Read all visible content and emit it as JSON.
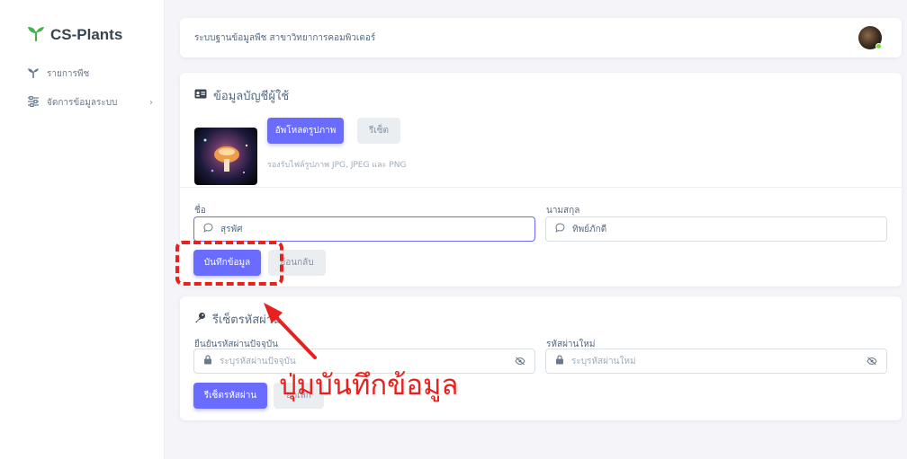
{
  "sidebar": {
    "brand": "CS-Plants",
    "items": [
      {
        "label": "รายการพืช"
      },
      {
        "label": "จัดการข้อมูลระบบ"
      }
    ]
  },
  "navbar": {
    "title": "ระบบฐานข้อมูลพืช สาขาวิทยาการคอมพิวเตอร์"
  },
  "account": {
    "title": "ข้อมูลบัญชีผู้ใช้",
    "upload_label": "อัพโหลดรูปภาพ",
    "reset_label": "รีเซ็ต",
    "upload_hint": "รองรับไฟล์รูปภาพ JPG, JPEG และ PNG",
    "first_name_label": "ชื่อ",
    "first_name_value": "สุรพัศ",
    "last_name_label": "นามสกุล",
    "last_name_value": "ทิพย์ภักดี",
    "save_label": "บันทึกข้อมูล",
    "back_label": "ย้อนกลับ"
  },
  "password": {
    "title": "รีเซ็ตรหัสผ่าน",
    "current_label": "ยืนยันรหัสผ่านปัจจุบัน",
    "current_placeholder": "ระบุรหัสผ่านปัจจุบัน",
    "new_label": "รหัสผ่านใหม่",
    "new_placeholder": "ระบุรหัสผ่านใหม่",
    "reset_label": "รีเซ็ตรหัสผ่าน",
    "cancel_label": "ยกเลิก"
  },
  "annotation": {
    "text": "ปุ่มบันทึกข้อมูล",
    "color": "#e8201e"
  },
  "colors": {
    "primary": "#696cff",
    "brand_green": "#4caf50"
  }
}
